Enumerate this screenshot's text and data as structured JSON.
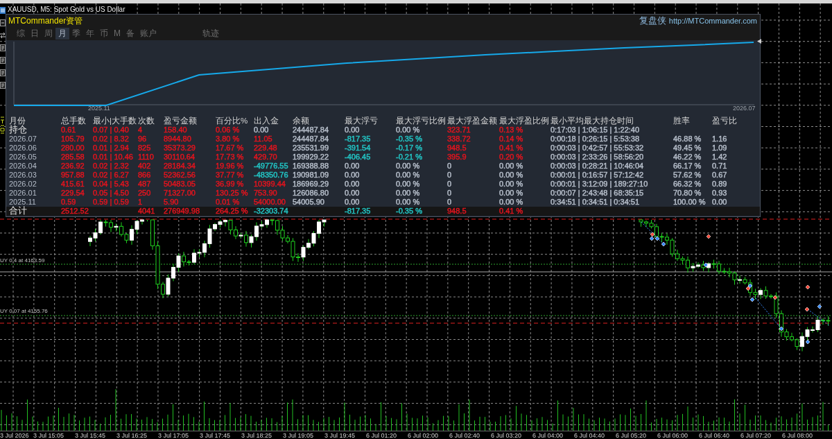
{
  "chart_window": {
    "title": "XAUUSD, M5: Spot Gold vs US Dollar",
    "order_lines": [
      {
        "label": "UY 0.4 at 4163.59"
      },
      {
        "label": "UY 0.07 at 4155.76"
      }
    ],
    "time_axis": [
      "3 Jul 2026",
      "3 Jul 15:05",
      "3 Jul 15:45",
      "3 Jul 16:25",
      "3 Jul 17:05",
      "3 Jul 17:45",
      "3 Jul 18:25",
      "3 Jul 19:05",
      "3 Jul 19:45",
      "6 Jul 01:20",
      "6 Jul 02:00",
      "6 Jul 02:40",
      "6 Jul 03:20",
      "6 Jul 04:00",
      "6 Jul 04:40",
      "6 Jul 05:20",
      "6 Jul 06:00",
      "6 Jul 06:40",
      "6 Jul 07:20",
      "6 Jul 08:00"
    ]
  },
  "panel": {
    "brand": "MTCommander资管",
    "site_name": "复盘侠",
    "site_url": "http://MTCommander.com",
    "tab_groups": [
      {
        "tabs": [
          {
            "label": "综",
            "selected": false
          },
          {
            "label": "日",
            "selected": false
          },
          {
            "label": "周",
            "selected": false
          },
          {
            "label": "月",
            "selected": true
          },
          {
            "label": "季",
            "selected": false
          },
          {
            "label": "年",
            "selected": false
          },
          {
            "label": "币",
            "selected": false
          },
          {
            "label": "M",
            "selected": false
          },
          {
            "label": "备",
            "selected": false
          },
          {
            "label": "账户",
            "selected": false
          }
        ]
      },
      {
        "tabs": [
          {
            "label": "轨迹",
            "selected": false
          }
        ]
      }
    ],
    "equity_chart": {
      "x_labels": [
        "2025.11",
        "2026.07"
      ]
    },
    "table": {
      "columns": [
        "月份",
        "总手数",
        "最小|大手数",
        "次数",
        "盈亏金额",
        "百分比%",
        "出入金",
        "余额",
        "最大浮亏",
        "最大浮亏比例",
        "最大浮盈金额",
        "最大浮盈比例",
        "最小平均最大持仓时间",
        "胜率",
        "盈亏比"
      ],
      "rows": [
        {
          "kind": "position",
          "month": "持仓",
          "total_lots": {
            "text": "0.61",
            "color": "#e0141e"
          },
          "min_max_lots": {
            "text": "0.07 | 0.40",
            "color": "#e0141e"
          },
          "trades": {
            "text": "4",
            "color": "#e0141e"
          },
          "pnl": {
            "text": "158.40",
            "color": "#e0141e"
          },
          "percent": {
            "text": "0.06 %",
            "color": "#e0141e"
          },
          "deposit": {
            "text": "0.00",
            "color": "#b4bcc8"
          },
          "balance": {
            "text": "244487.84",
            "color": "#b4bcc8"
          },
          "max_float_loss": {
            "text": "0.00",
            "color": "#b4bcc8"
          },
          "max_float_loss_pct": {
            "text": "0.00 %",
            "color": "#b4bcc8"
          },
          "max_float_profit": {
            "text": "323.71",
            "color": "#e0141e"
          },
          "max_float_profit_pct": {
            "text": "0.13 %",
            "color": "#e0141e"
          },
          "hold_time": {
            "text": "0:17:03 | 1:06:15 | 1:22:40",
            "color": "#b4bcc8"
          }
        },
        {
          "kind": "month",
          "month": "2026.07",
          "total_lots": {
            "text": "105.79",
            "color": "#e0141e"
          },
          "min_max_lots": {
            "text": "0.02 | 8.32",
            "color": "#e0141e"
          },
          "trades": {
            "text": "96",
            "color": "#e0141e"
          },
          "pnl": {
            "text": "8944.80",
            "color": "#e0141e"
          },
          "percent": {
            "text": "3.80 %",
            "color": "#e0141e"
          },
          "deposit": {
            "text": "11.05",
            "color": "#e0141e"
          },
          "balance": {
            "text": "244487.84",
            "color": "#b4bcc8"
          },
          "max_float_loss": {
            "text": "-817.35",
            "color": "#22c3c3"
          },
          "max_float_loss_pct": {
            "text": "-0.35 %",
            "color": "#22c3c3"
          },
          "max_float_profit": {
            "text": "338.72",
            "color": "#e0141e"
          },
          "max_float_profit_pct": {
            "text": "0.14 %",
            "color": "#e0141e"
          },
          "hold_time": {
            "text": "0:00:18 | 0:26:15 | 5:53:38",
            "color": "#b4bcc8"
          },
          "win_rate": {
            "text": "46.88 %",
            "color": "#b4bcc8"
          },
          "pl_ratio": {
            "text": "1.16",
            "color": "#b4bcc8"
          }
        },
        {
          "kind": "month",
          "month": "2026.06",
          "total_lots": {
            "text": "280.00",
            "color": "#e0141e"
          },
          "min_max_lots": {
            "text": "0.01 | 2.94",
            "color": "#e0141e"
          },
          "trades": {
            "text": "825",
            "color": "#e0141e"
          },
          "pnl": {
            "text": "35373.29",
            "color": "#e0141e"
          },
          "percent": {
            "text": "17.67 %",
            "color": "#e0141e"
          },
          "deposit": {
            "text": "229.48",
            "color": "#e0141e"
          },
          "balance": {
            "text": "235531.99",
            "color": "#b4bcc8"
          },
          "max_float_loss": {
            "text": "-391.54",
            "color": "#22c3c3"
          },
          "max_float_loss_pct": {
            "text": "-0.17 %",
            "color": "#22c3c3"
          },
          "max_float_profit": {
            "text": "948.5",
            "color": "#e0141e"
          },
          "max_float_profit_pct": {
            "text": "0.41 %",
            "color": "#e0141e"
          },
          "hold_time": {
            "text": "0:00:03 | 0:42:57 | 55:53:32",
            "color": "#b4bcc8"
          },
          "win_rate": {
            "text": "49.45 %",
            "color": "#b4bcc8"
          },
          "pl_ratio": {
            "text": "1.09",
            "color": "#b4bcc8"
          }
        },
        {
          "kind": "month",
          "month": "2026.05",
          "total_lots": {
            "text": "285.58",
            "color": "#e0141e"
          },
          "min_max_lots": {
            "text": "0.01 | 10.46",
            "color": "#e0141e"
          },
          "trades": {
            "text": "1110",
            "color": "#e0141e"
          },
          "pnl": {
            "text": "30110.64",
            "color": "#e0141e"
          },
          "percent": {
            "text": "17.73 %",
            "color": "#e0141e"
          },
          "deposit": {
            "text": "429.70",
            "color": "#e0141e"
          },
          "balance": {
            "text": "199929.22",
            "color": "#b4bcc8"
          },
          "max_float_loss": {
            "text": "-406.45",
            "color": "#22c3c3"
          },
          "max_float_loss_pct": {
            "text": "-0.21 %",
            "color": "#22c3c3"
          },
          "max_float_profit": {
            "text": "395.9",
            "color": "#e0141e"
          },
          "max_float_profit_pct": {
            "text": "0.20 %",
            "color": "#e0141e"
          },
          "hold_time": {
            "text": "0:00:03 | 2:33:26 | 58:56:20",
            "color": "#b4bcc8"
          },
          "win_rate": {
            "text": "46.22 %",
            "color": "#b4bcc8"
          },
          "pl_ratio": {
            "text": "1.42",
            "color": "#b4bcc8"
          }
        },
        {
          "kind": "month",
          "month": "2026.04",
          "total_lots": {
            "text": "236.92",
            "color": "#e0141e"
          },
          "min_max_lots": {
            "text": "0.02 | 2.32",
            "color": "#e0141e"
          },
          "trades": {
            "text": "402",
            "color": "#e0141e"
          },
          "pnl": {
            "text": "28184.34",
            "color": "#e0141e"
          },
          "percent": {
            "text": "19.96 %",
            "color": "#e0141e"
          },
          "deposit": {
            "text": "-49776.55",
            "color": "#22c3c3"
          },
          "balance": {
            "text": "169388.88",
            "color": "#b4bcc8"
          },
          "max_float_loss": {
            "text": "0.00",
            "color": "#b4bcc8"
          },
          "max_float_loss_pct": {
            "text": "0.00 %",
            "color": "#b4bcc8"
          },
          "max_float_profit": {
            "text": "0",
            "color": "#b4bcc8"
          },
          "max_float_profit_pct": {
            "text": "0.00 %",
            "color": "#b4bcc8"
          },
          "hold_time": {
            "text": "0:00:03 | 0:28:21 | 10:46:04",
            "color": "#b4bcc8"
          },
          "win_rate": {
            "text": "66.17 %",
            "color": "#b4bcc8"
          },
          "pl_ratio": {
            "text": "0.71",
            "color": "#b4bcc8"
          }
        },
        {
          "kind": "month",
          "month": "2026.03",
          "total_lots": {
            "text": "957.88",
            "color": "#e0141e"
          },
          "min_max_lots": {
            "text": "0.02 | 6.27",
            "color": "#e0141e"
          },
          "trades": {
            "text": "866",
            "color": "#e0141e"
          },
          "pnl": {
            "text": "52362.56",
            "color": "#e0141e"
          },
          "percent": {
            "text": "37.77 %",
            "color": "#e0141e"
          },
          "deposit": {
            "text": "-48350.76",
            "color": "#22c3c3"
          },
          "balance": {
            "text": "190981.09",
            "color": "#b4bcc8"
          },
          "max_float_loss": {
            "text": "0.00",
            "color": "#b4bcc8"
          },
          "max_float_loss_pct": {
            "text": "0.00 %",
            "color": "#b4bcc8"
          },
          "max_float_profit": {
            "text": "0",
            "color": "#b4bcc8"
          },
          "max_float_profit_pct": {
            "text": "0.00 %",
            "color": "#b4bcc8"
          },
          "hold_time": {
            "text": "0:00:01 | 0:16:57 | 57:12:42",
            "color": "#b4bcc8"
          },
          "win_rate": {
            "text": "57.62 %",
            "color": "#b4bcc8"
          },
          "pl_ratio": {
            "text": "0.67",
            "color": "#b4bcc8"
          }
        },
        {
          "kind": "month",
          "month": "2026.02",
          "total_lots": {
            "text": "415.61",
            "color": "#e0141e"
          },
          "min_max_lots": {
            "text": "0.04 | 5.43",
            "color": "#e0141e"
          },
          "trades": {
            "text": "487",
            "color": "#e0141e"
          },
          "pnl": {
            "text": "50483.05",
            "color": "#e0141e"
          },
          "percent": {
            "text": "36.99 %",
            "color": "#e0141e"
          },
          "deposit": {
            "text": "10399.44",
            "color": "#e0141e"
          },
          "balance": {
            "text": "186969.29",
            "color": "#b4bcc8"
          },
          "max_float_loss": {
            "text": "0.00",
            "color": "#b4bcc8"
          },
          "max_float_loss_pct": {
            "text": "0.00 %",
            "color": "#b4bcc8"
          },
          "max_float_profit": {
            "text": "0",
            "color": "#b4bcc8"
          },
          "max_float_profit_pct": {
            "text": "0.00 %",
            "color": "#b4bcc8"
          },
          "hold_time": {
            "text": "0:00:01 | 3:12:09 | 189:27:10",
            "color": "#b4bcc8"
          },
          "win_rate": {
            "text": "66.32 %",
            "color": "#b4bcc8"
          },
          "pl_ratio": {
            "text": "0.89",
            "color": "#b4bcc8"
          }
        },
        {
          "kind": "month",
          "month": "2026.01",
          "total_lots": {
            "text": "229.54",
            "color": "#e0141e"
          },
          "min_max_lots": {
            "text": "0.05 | 4.50",
            "color": "#e0141e"
          },
          "trades": {
            "text": "250",
            "color": "#e0141e"
          },
          "pnl": {
            "text": "71327.00",
            "color": "#e0141e"
          },
          "percent": {
            "text": "130.25 %",
            "color": "#e0141e"
          },
          "deposit": {
            "text": "753.90",
            "color": "#e0141e"
          },
          "balance": {
            "text": "126086.80",
            "color": "#b4bcc8"
          },
          "max_float_loss": {
            "text": "0.00",
            "color": "#b4bcc8"
          },
          "max_float_loss_pct": {
            "text": "0.00 %",
            "color": "#b4bcc8"
          },
          "max_float_profit": {
            "text": "0",
            "color": "#b4bcc8"
          },
          "max_float_profit_pct": {
            "text": "0.00 %",
            "color": "#b4bcc8"
          },
          "hold_time": {
            "text": "0:00:07 | 2:43:48 | 68:35:15",
            "color": "#b4bcc8"
          },
          "win_rate": {
            "text": "70.80 %",
            "color": "#b4bcc8"
          },
          "pl_ratio": {
            "text": "0.93",
            "color": "#b4bcc8"
          }
        },
        {
          "kind": "month",
          "month": "2025.11",
          "total_lots": {
            "text": "0.59",
            "color": "#e0141e"
          },
          "min_max_lots": {
            "text": "0.59 | 0.59",
            "color": "#e0141e"
          },
          "trades": {
            "text": "1",
            "color": "#e0141e"
          },
          "pnl": {
            "text": "5.90",
            "color": "#e0141e"
          },
          "percent": {
            "text": "0.01 %",
            "color": "#e0141e"
          },
          "deposit": {
            "text": "54000.00",
            "color": "#e0141e"
          },
          "balance": {
            "text": "54005.90",
            "color": "#b4bcc8"
          },
          "max_float_loss": {
            "text": "0.00",
            "color": "#b4bcc8"
          },
          "max_float_loss_pct": {
            "text": "0.00 %",
            "color": "#b4bcc8"
          },
          "max_float_profit": {
            "text": "0",
            "color": "#b4bcc8"
          },
          "max_float_profit_pct": {
            "text": "0.00 %",
            "color": "#b4bcc8"
          },
          "hold_time": {
            "text": "0:34:51 | 0:34:51 | 0:34:51",
            "color": "#b4bcc8"
          },
          "win_rate": {
            "text": "100.00 %",
            "color": "#b4bcc8"
          },
          "pl_ratio": {
            "text": "0.00",
            "color": "#b4bcc8"
          }
        },
        {
          "kind": "total",
          "month": "合计",
          "total_lots": {
            "text": "2512.52",
            "color": "#e0141e"
          },
          "trades": {
            "text": "4041",
            "color": "#e0141e"
          },
          "pnl": {
            "text": "276949.98",
            "color": "#e0141e"
          },
          "percent": {
            "text": "264.25 %",
            "color": "#e0141e"
          },
          "deposit": {
            "text": "-32303.74",
            "color": "#22c3c3"
          },
          "max_float_loss": {
            "text": "-817.35",
            "color": "#22c3c3"
          },
          "max_float_loss_pct": {
            "text": "-0.35 %",
            "color": "#22c3c3"
          },
          "max_float_profit": {
            "text": "948.5",
            "color": "#e0141e"
          },
          "max_float_profit_pct": {
            "text": "0.41 %",
            "color": "#e0141e"
          }
        }
      ]
    }
  }
}
